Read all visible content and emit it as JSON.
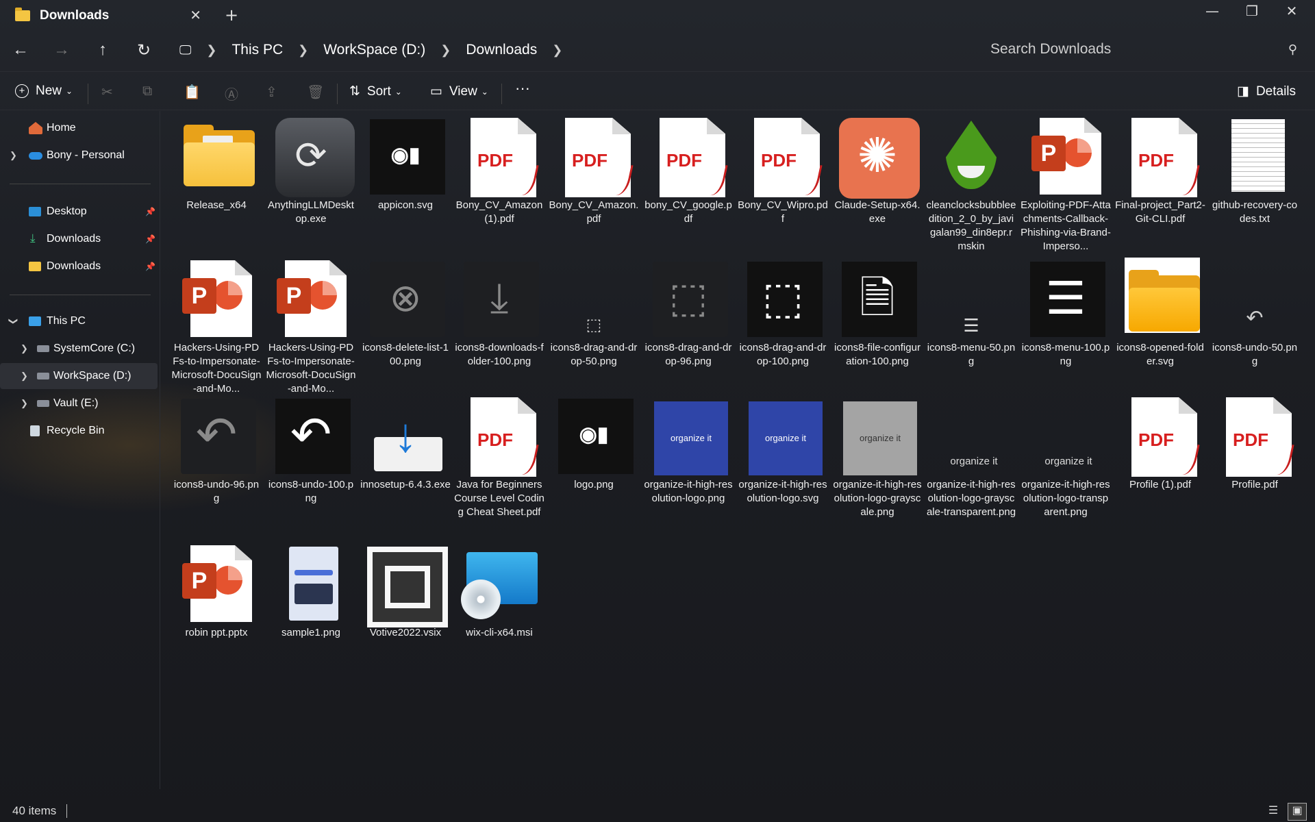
{
  "window": {
    "tab_title": "Downloads",
    "new_tab": "+",
    "minimize": "—",
    "restore": "❐",
    "close": "✕"
  },
  "nav": {
    "back": "←",
    "forward": "→",
    "up": "↑",
    "refresh": "↻"
  },
  "breadcrumb": [
    "This PC",
    "WorkSpace (D:)",
    "Downloads"
  ],
  "search": {
    "placeholder": "Search Downloads"
  },
  "toolbar": {
    "new_label": "New",
    "sort_label": "Sort",
    "view_label": "View",
    "more_label": "···",
    "details_label": "Details"
  },
  "sidebar": {
    "home": "Home",
    "personal": "Bony - Personal",
    "pinned": [
      "Desktop",
      "Downloads",
      "Downloads"
    ],
    "this_pc": "This PC",
    "drives": [
      "SystemCore (C:)",
      "WorkSpace (D:)",
      "Vault (E:)"
    ],
    "recycle": "Recycle Bin"
  },
  "files": [
    {
      "name": "Release_x64",
      "kind": "folder"
    },
    {
      "name": "AnythingLLMDesktop.exe",
      "kind": "anything"
    },
    {
      "name": "appicon.svg",
      "kind": "appicon"
    },
    {
      "name": "Bony_CV_Amazon (1).pdf",
      "kind": "pdf"
    },
    {
      "name": "Bony_CV_Amazon.pdf",
      "kind": "pdf"
    },
    {
      "name": "bony_CV_google.pdf",
      "kind": "pdf"
    },
    {
      "name": "Bony_CV_Wipro.pdf",
      "kind": "pdf"
    },
    {
      "name": "Claude-Setup-x64.exe",
      "kind": "claude"
    },
    {
      "name": "cleanclocksbubbleedition_2_0_by_javigalan99_din8epr.rmskin",
      "kind": "drop"
    },
    {
      "name": "Exploiting-PDF-Attachments-Callback-Phishing-via-Brand-Imperso...",
      "kind": "ppt"
    },
    {
      "name": "Final-project_Part2-Git-CLI.pdf",
      "kind": "pdf"
    },
    {
      "name": "github-recovery-codes.txt",
      "kind": "txt"
    },
    {
      "name": "Hackers-Using-PDFs-to-Impersonate-Microsoft-DocuSign-and-Mo...",
      "kind": "ppt"
    },
    {
      "name": "Hackers-Using-PDFs-to-Impersonate-Microsoft-DocuSign-and-Mo...",
      "kind": "ppt"
    },
    {
      "name": "icons8-delete-list-100.png",
      "kind": "deletelist"
    },
    {
      "name": "icons8-downloads-folder-100.png",
      "kind": "dlfolder"
    },
    {
      "name": "icons8-drag-and-drop-50.png",
      "kind": "dragsmall"
    },
    {
      "name": "icons8-drag-and-drop-96.png",
      "kind": "dragmid"
    },
    {
      "name": "icons8-drag-and-drop-100.png",
      "kind": "dragbig"
    },
    {
      "name": "icons8-file-configuration-100.png",
      "kind": "fileconf"
    },
    {
      "name": "icons8-menu-50.png",
      "kind": "menusmall"
    },
    {
      "name": "icons8-menu-100.png",
      "kind": "menubig"
    },
    {
      "name": "icons8-opened-folder.svg",
      "kind": "openfolder"
    },
    {
      "name": "icons8-undo-50.png",
      "kind": "undosmall"
    },
    {
      "name": "icons8-undo-96.png",
      "kind": "undogrey"
    },
    {
      "name": "icons8-undo-100.png",
      "kind": "undoblack"
    },
    {
      "name": "innosetup-6.4.3.exe",
      "kind": "inno"
    },
    {
      "name": "Java for Beginners Course Level Coding Cheat Sheet.pdf",
      "kind": "pdf"
    },
    {
      "name": "logo.png",
      "kind": "appicon"
    },
    {
      "name": "organize-it-high-resolution-logo.png",
      "kind": "orgblue"
    },
    {
      "name": "organize-it-high-resolution-logo.svg",
      "kind": "orgblue"
    },
    {
      "name": "organize-it-high-resolution-logo-grayscale.png",
      "kind": "orggrey"
    },
    {
      "name": "organize-it-high-resolution-logo-grayscale-transparent.png",
      "kind": "orgclear"
    },
    {
      "name": "organize-it-high-resolution-logo-transparent.png",
      "kind": "orgclear"
    },
    {
      "name": "Profile (1).pdf",
      "kind": "pdf"
    },
    {
      "name": "Profile.pdf",
      "kind": "pdf"
    },
    {
      "name": "robin ppt.pptx",
      "kind": "ppt"
    },
    {
      "name": "sample1.png",
      "kind": "sample"
    },
    {
      "name": "Votive2022.vsix",
      "kind": "votive"
    },
    {
      "name": "wix-cli-x64.msi",
      "kind": "msi"
    }
  ],
  "thumb_text": {
    "pdf": "PDF",
    "ppt": "P",
    "org": "organize it"
  },
  "status": {
    "count": "40 items"
  }
}
